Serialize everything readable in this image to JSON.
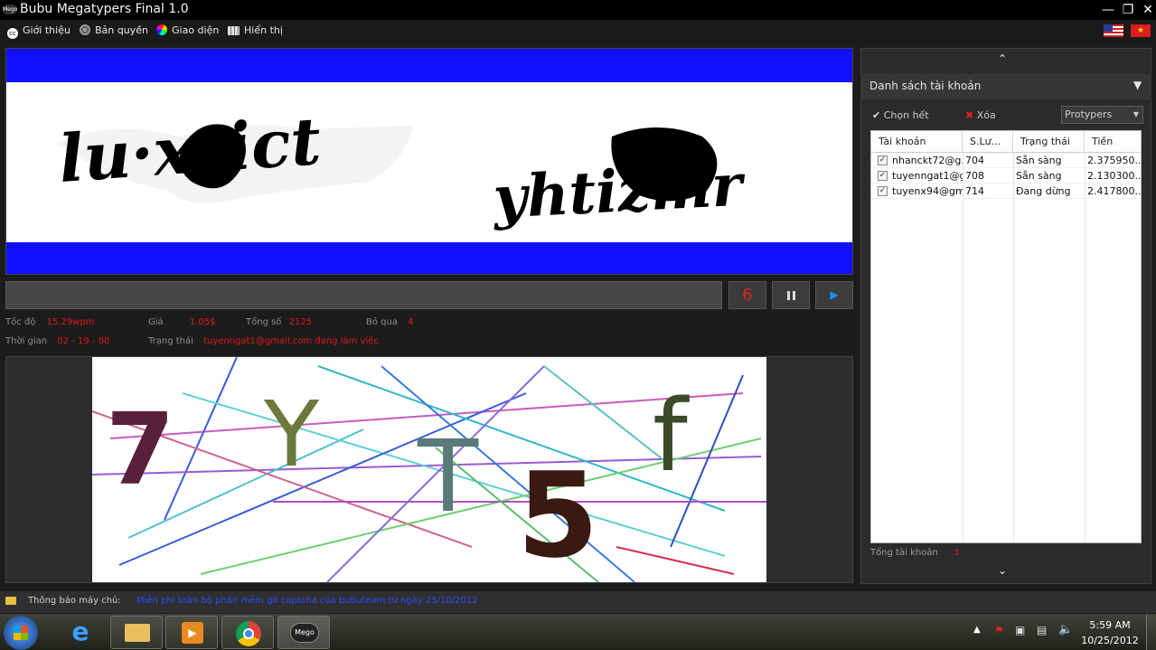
{
  "window": {
    "title": "Bubu Megatypers Final 1.0",
    "logo_text": "Mego"
  },
  "menu": {
    "items": [
      {
        "label": "Giới thiệu",
        "icon": "cc-icon"
      },
      {
        "label": "Bản quyền",
        "icon": "fingerprint-icon"
      },
      {
        "label": "Giao diện",
        "icon": "color-wheel-icon"
      },
      {
        "label": "Hiển thị",
        "icon": "display-icon"
      }
    ],
    "flags": [
      "us-flag",
      "vn-flag"
    ]
  },
  "captcha_top": {
    "words": [
      "lu·xrict",
      "yhtizmr"
    ]
  },
  "answer": {
    "value": "",
    "countdown": "6"
  },
  "stats": {
    "speed_label": "Tốc độ",
    "speed_value": "15.29wpm",
    "price_label": "Giá",
    "price_value": "1.05$",
    "total_label": "Tổng số",
    "total_value": "2125",
    "skip_label": "Bỏ qua",
    "skip_value": "4",
    "time_label": "Thời gian",
    "time_value": "02 - 19 - 00",
    "status_label": "Trạng thái",
    "status_value": "tuyenngat1@gmail.com đang làm việc"
  },
  "captcha_bottom": {
    "glyphs": [
      "7",
      "Y",
      "T",
      "5",
      "f"
    ]
  },
  "accounts_panel": {
    "title": "Danh sách tài khoản",
    "select_all": "Chọn hết",
    "delete": "Xóa",
    "service": "Protypers",
    "columns": [
      "Tài khoản",
      "S.Lư...",
      "Trạng thái",
      "Tiền"
    ],
    "rows": [
      {
        "account": "nhanckt72@g...",
        "count": "704",
        "status": "Sẵn sàng",
        "money": "2.375950..."
      },
      {
        "account": "tuyenngat1@g...",
        "count": "708",
        "status": "Sẵn sàng",
        "money": "2.130300..."
      },
      {
        "account": "tuyenx94@gm...",
        "count": "714",
        "status": "Đang dừng",
        "money": "2.417800..."
      }
    ],
    "total_label": "Tổng tài khoản",
    "total_value": "3"
  },
  "notice": {
    "label": "Thông báo máy chủ:",
    "message": "Miễn phí toàn bộ phần mềm gõ captcha của bubuteam từ ngày 25/10/2012"
  },
  "taskbar": {
    "apps": [
      "start-orb",
      "internet-explorer",
      "file-explorer",
      "media-player",
      "chrome",
      "mego"
    ],
    "mego_label": "Mego",
    "time": "5:59 AM",
    "date": "10/25/2012"
  },
  "colors": {
    "accent_red": "#e01818",
    "captcha_blue": "#1010ff",
    "notice_blue": "#2a4bff"
  }
}
